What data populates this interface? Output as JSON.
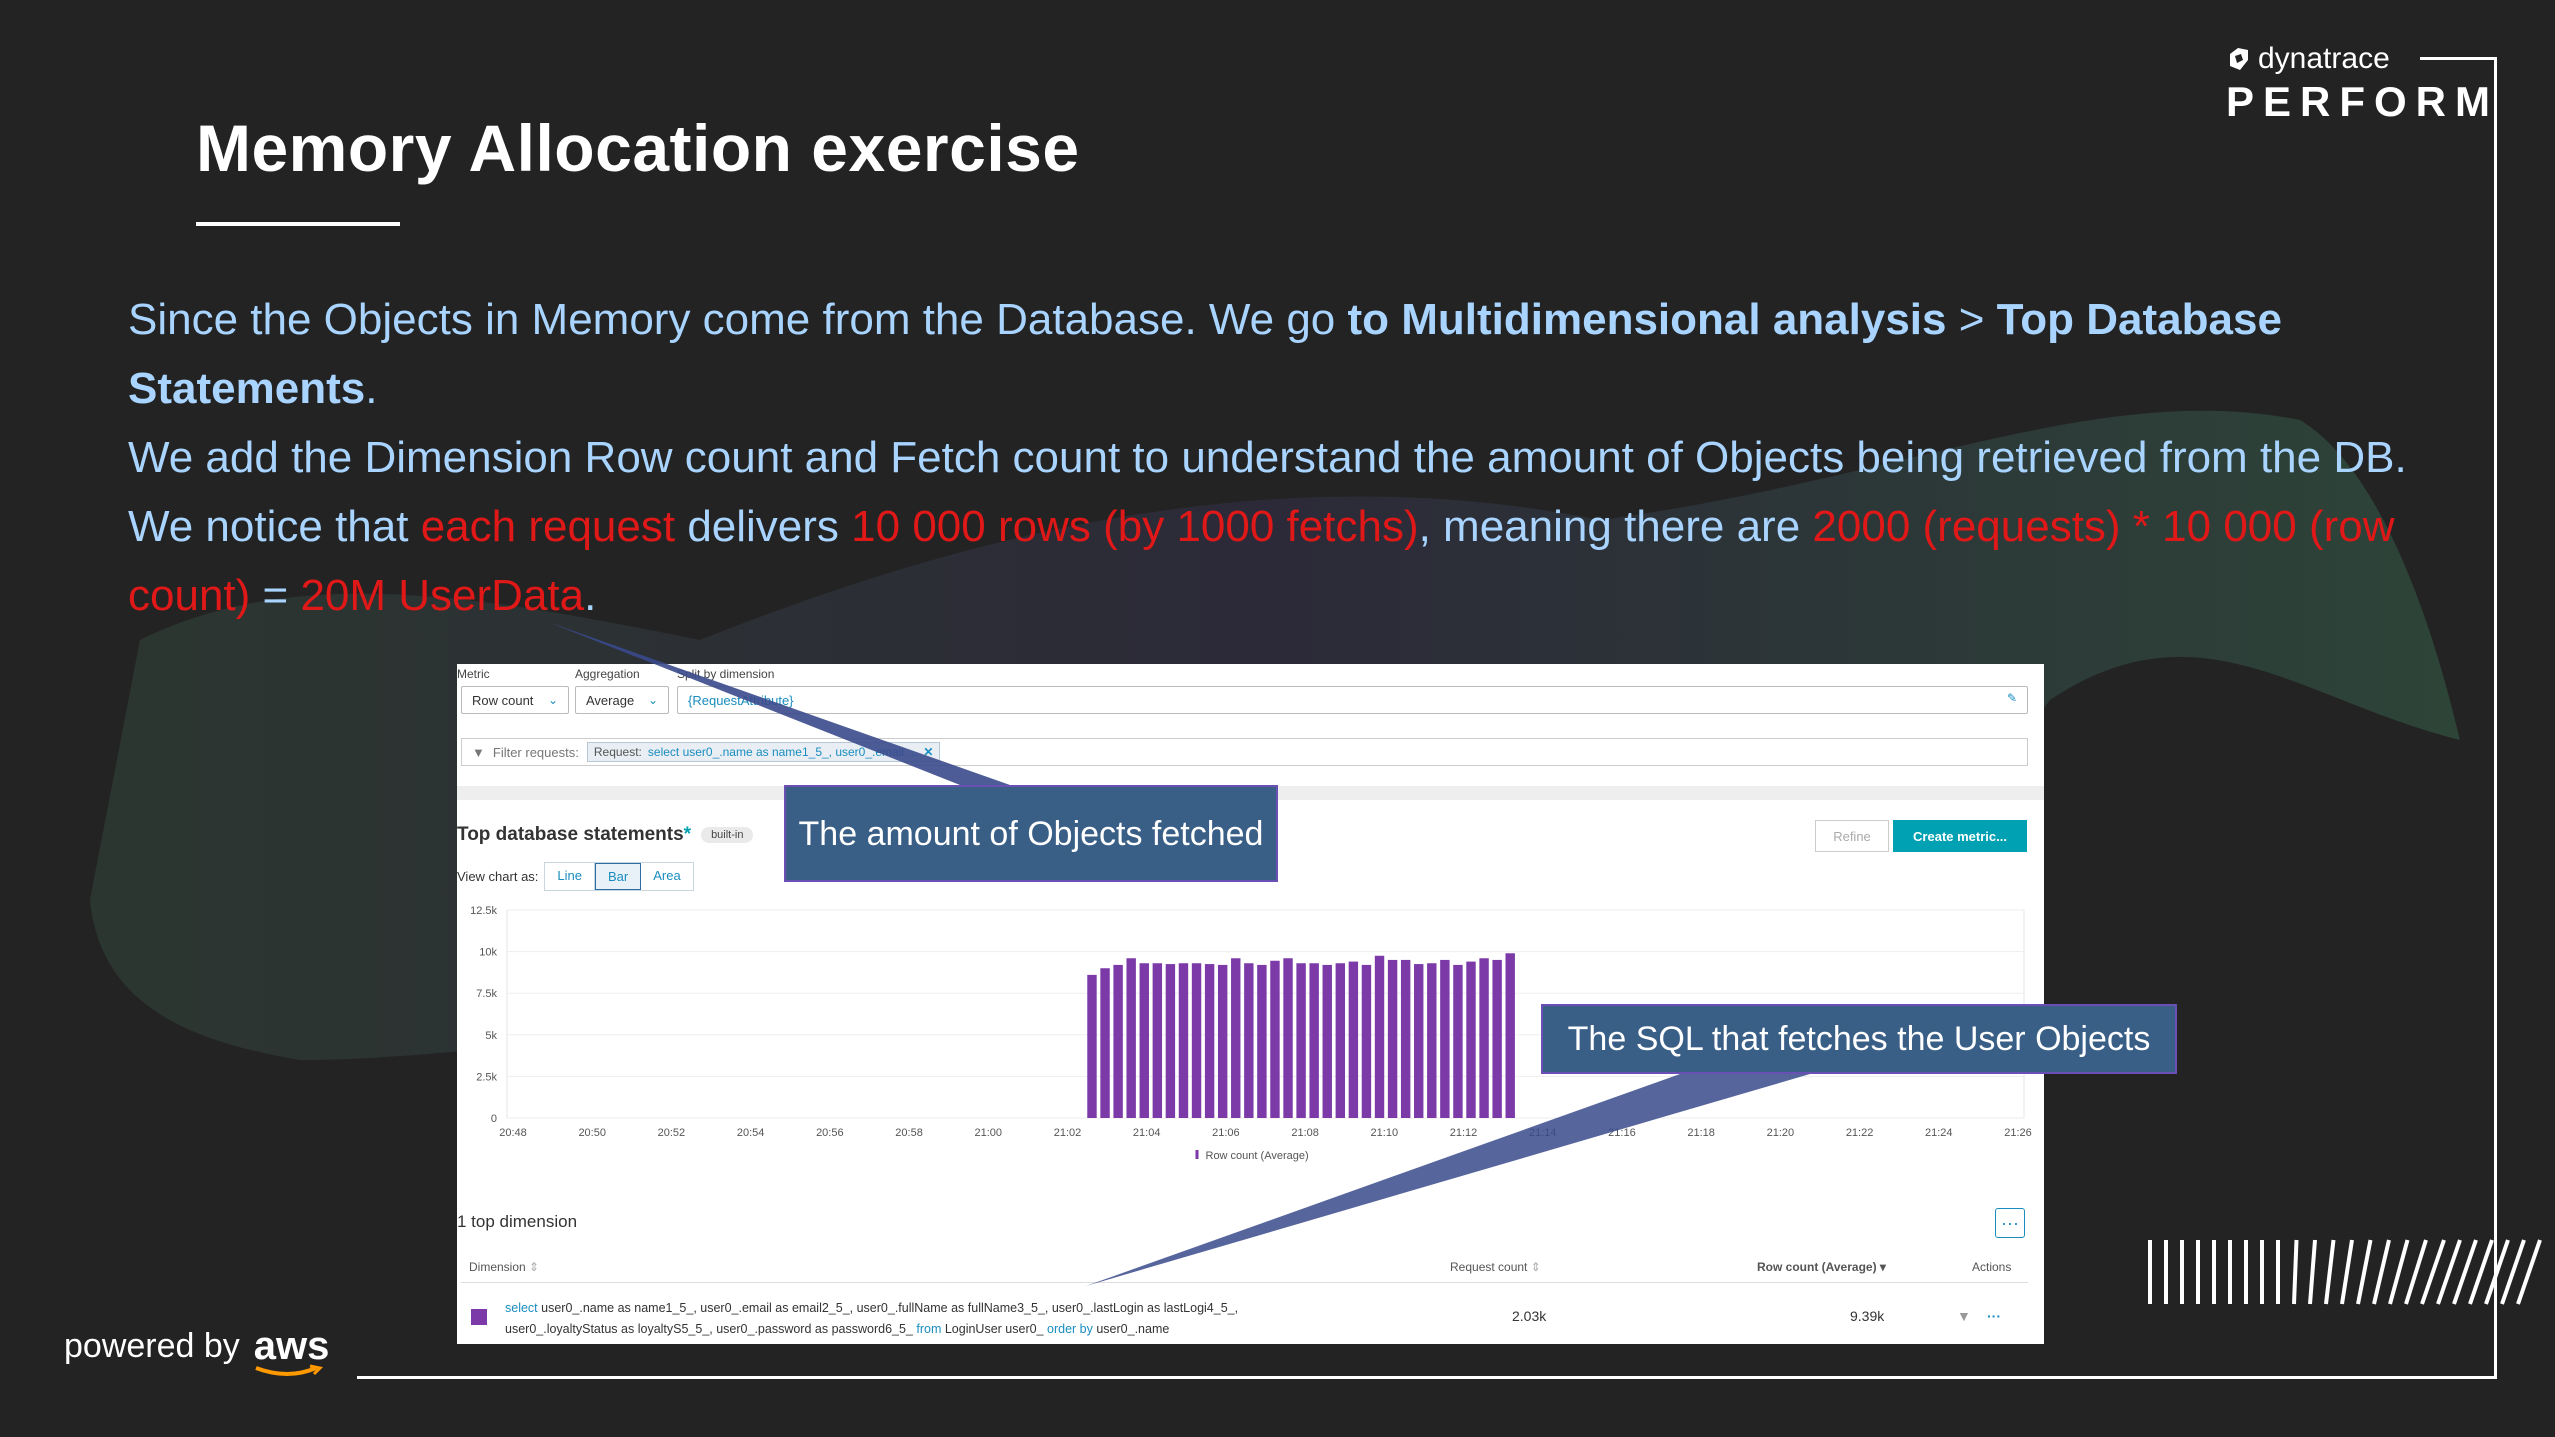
{
  "slide": {
    "title": "Memory Allocation exercise",
    "brand": {
      "line1": "dynatrace",
      "line2": "PERFORM"
    },
    "powered_by": "powered by",
    "aws": "aws",
    "para": {
      "s1": "Since the Objects in Memory come from the Database. We go ",
      "s2": "to Multidimensional analysis",
      "s3": " > ",
      "s4": "Top Database Statements",
      "s5": ".",
      "s6": "We add the Dimension Row count and Fetch count to understand the amount of Objects being retrieved from the DB. We notice that ",
      "s7": "each request",
      "s8": " delivers ",
      "s9": "10 000 rows (by 1000 fetchs)",
      "s10": ", meaning there are ",
      "s11": "2000 (requests) * 10 000 (row count)",
      "s12": " = ",
      "s13": "20M UserData",
      "s14": "."
    },
    "callouts": {
      "objects": "The amount of Objects fetched",
      "sql": "The SQL that fetches the User Objects"
    }
  },
  "app": {
    "labels": {
      "metric": "Metric",
      "aggregation": "Aggregation",
      "split": "Split by dimension"
    },
    "metric_value": "Row count",
    "aggregation_value": "Average",
    "split_value": "{RequestAttribute}",
    "filter_label": "Filter requests:",
    "filter_chip_key": "Request:",
    "filter_chip_value": "select user0_.name as name1_5_, user0_.email ...",
    "card_title": "Top database statements",
    "card_star": "*",
    "card_tag": "built-in",
    "view_chart_as": "View chart as:",
    "view_options": [
      "Line",
      "Bar",
      "Area"
    ],
    "view_selected": "Bar",
    "refine": "Refine",
    "create_metric": "Create metric...",
    "section_title": "1 top dimension",
    "more_menu": "···",
    "table": {
      "headers": {
        "dimension": "Dimension",
        "request_count": "Request count",
        "row_count": "Row count (Average)",
        "actions": "Actions"
      },
      "row": {
        "sql_part1": "user0_.name as name1_5_, user0_.email as email2_5_, user0_.fullName as fullName3_5_, user0_.lastLogin as lastLogi4_5_,",
        "sql_part2": "user0_.loyaltyStatus as loyaltyS5_5_, user0_.password as password6_5_",
        "sql_part3": "LoginUser user0_",
        "sql_part4": "user0_.name",
        "kw_select": "select",
        "kw_from": "from",
        "kw_order": "order by",
        "request_count": "2.03k",
        "row_count": "9.39k"
      }
    }
  },
  "chart_data": {
    "type": "bar",
    "title": "",
    "xlabel": "",
    "ylabel": "",
    "legend": "Row count (Average)",
    "legend_placement": "bottom-center",
    "ylim": [
      0,
      12500
    ],
    "y_ticks": [
      "0",
      "2.5k",
      "5k",
      "7.5k",
      "10k",
      "12.5k"
    ],
    "x_ticks": [
      "20:48",
      "20:50",
      "20:52",
      "20:54",
      "20:56",
      "20:58",
      "21:00",
      "21:02",
      "21:04",
      "21:06",
      "21:08",
      "21:10",
      "21:12",
      "21:14",
      "21:16",
      "21:18",
      "21:20",
      "21:22",
      "21:24",
      "21:26"
    ],
    "x_start": "20:48",
    "x_end": "21:26",
    "bar_interval_minutes": 0.33,
    "first_bar_time": "21:02.5",
    "series": [
      {
        "name": "Row count (Average)",
        "color": "#7b3aa8",
        "values": [
          8600,
          9000,
          9200,
          9600,
          9300,
          9300,
          9250,
          9300,
          9300,
          9250,
          9200,
          9600,
          9300,
          9200,
          9450,
          9600,
          9300,
          9300,
          9200,
          9300,
          9400,
          9200,
          9750,
          9500,
          9500,
          9250,
          9300,
          9500,
          9200,
          9400,
          9600,
          9500,
          9900
        ]
      }
    ],
    "grid": true
  },
  "colors": {
    "accent_text": "#a8d4ff",
    "highlight_red": "#e01818",
    "bar": "#7b3aa8",
    "button_teal": "#00a1b2",
    "link_blue": "#1a8dbf"
  }
}
